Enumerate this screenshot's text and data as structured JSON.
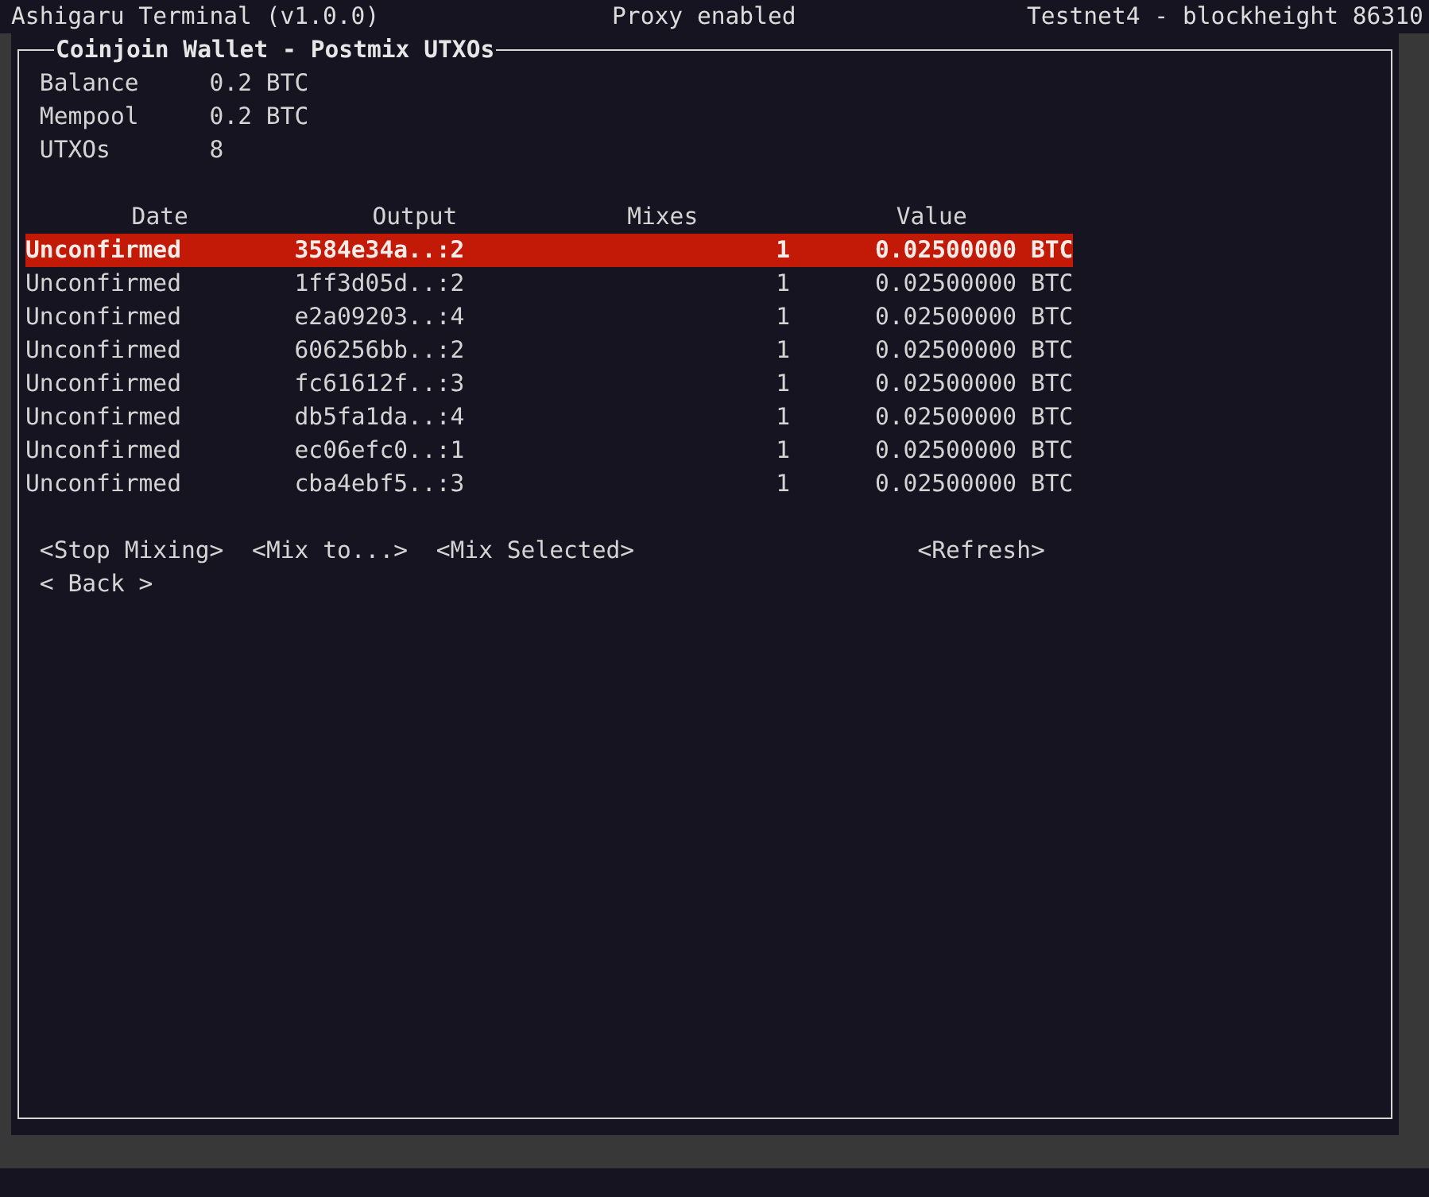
{
  "status_bar": {
    "app_title": "Ashigaru Terminal (v1.0.0)",
    "proxy": "Proxy enabled",
    "network": "Testnet4 - blockheight 86310"
  },
  "panel": {
    "title": "Coinjoin Wallet - Postmix UTXOs",
    "summary": [
      {
        "label": "Balance",
        "value": "0.2 BTC"
      },
      {
        "label": "Mempool",
        "value": "0.2 BTC"
      },
      {
        "label": "UTXOs",
        "value": "8"
      }
    ],
    "table": {
      "columns": [
        "Date",
        "Output",
        "Mixes",
        "Value"
      ],
      "rows": [
        {
          "date": "Unconfirmed",
          "output": "3584e34a..:2",
          "mixes": "1",
          "value": "0.02500000 BTC",
          "selected": true
        },
        {
          "date": "Unconfirmed",
          "output": "1ff3d05d..:2",
          "mixes": "1",
          "value": "0.02500000 BTC",
          "selected": false
        },
        {
          "date": "Unconfirmed",
          "output": "e2a09203..:4",
          "mixes": "1",
          "value": "0.02500000 BTC",
          "selected": false
        },
        {
          "date": "Unconfirmed",
          "output": "606256bb..:2",
          "mixes": "1",
          "value": "0.02500000 BTC",
          "selected": false
        },
        {
          "date": "Unconfirmed",
          "output": "fc61612f..:3",
          "mixes": "1",
          "value": "0.02500000 BTC",
          "selected": false
        },
        {
          "date": "Unconfirmed",
          "output": "db5fa1da..:4",
          "mixes": "1",
          "value": "0.02500000 BTC",
          "selected": false
        },
        {
          "date": "Unconfirmed",
          "output": "ec06efc0..:1",
          "mixes": "1",
          "value": "0.02500000 BTC",
          "selected": false
        },
        {
          "date": "Unconfirmed",
          "output": "cba4ebf5..:3",
          "mixes": "1",
          "value": "0.02500000 BTC",
          "selected": false
        }
      ]
    },
    "buttons": [
      {
        "label": "<Stop Mixing>",
        "kind": "action"
      },
      {
        "label": "<Mix to...>",
        "kind": "action"
      },
      {
        "label": "<Mix Selected>",
        "kind": "action"
      },
      {
        "label": "<Refresh>",
        "kind": "aside"
      },
      {
        "label": "< Back >",
        "kind": "back"
      }
    ]
  }
}
